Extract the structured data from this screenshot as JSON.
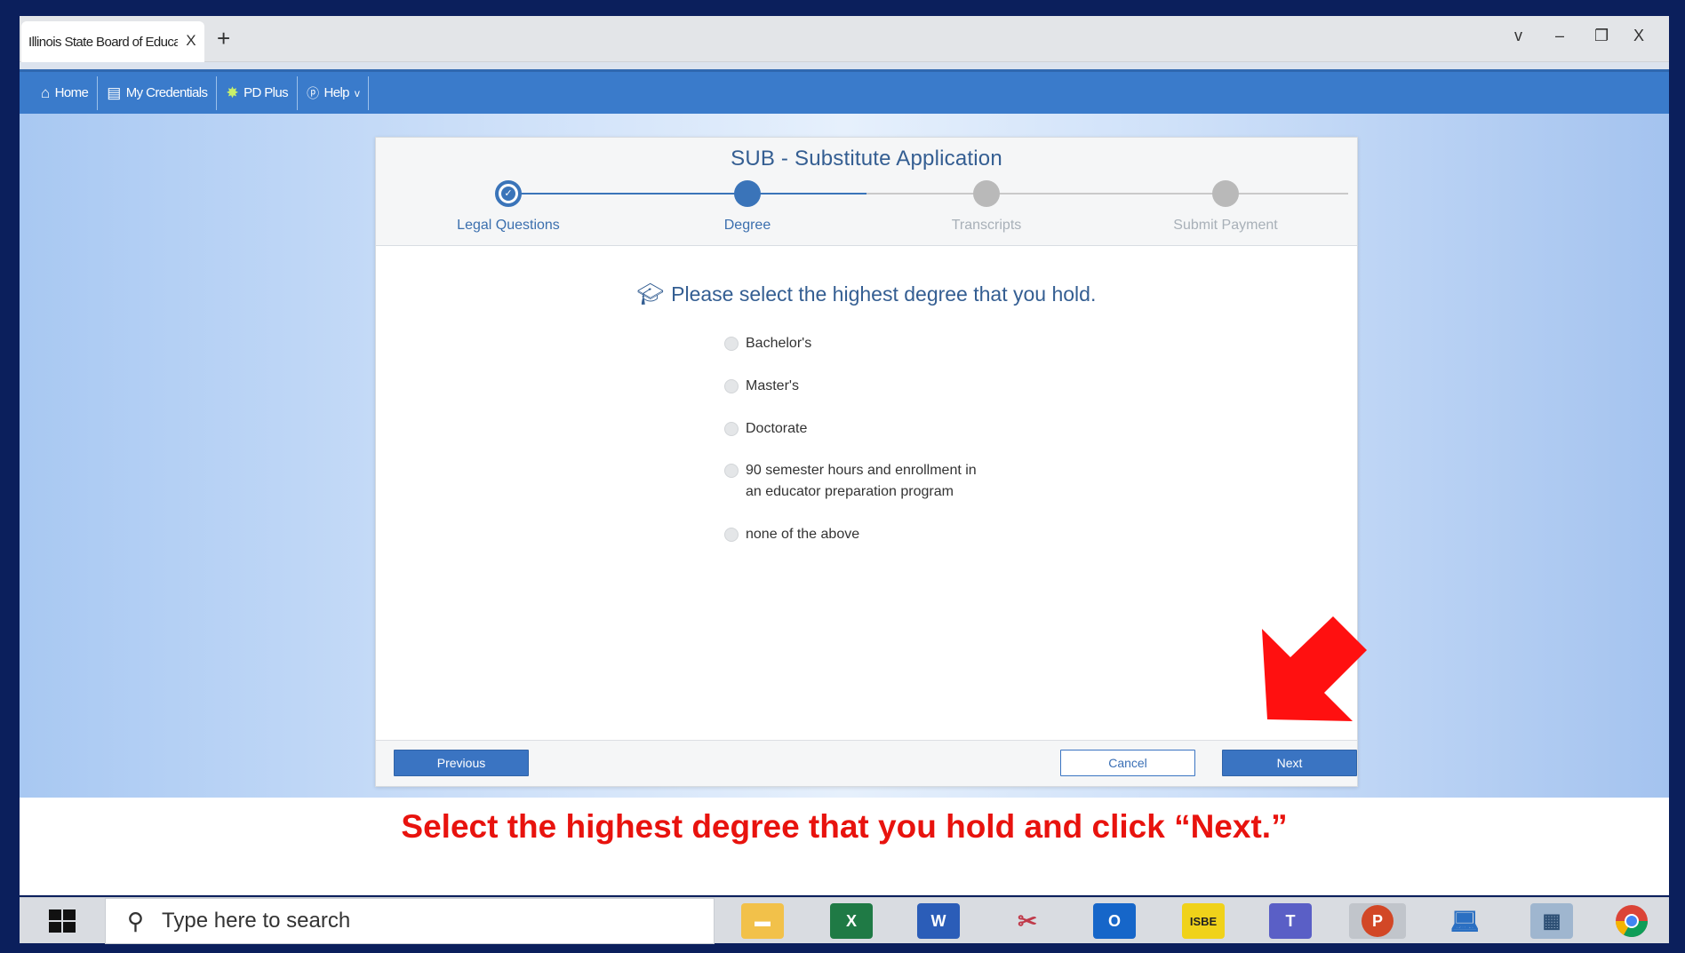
{
  "browser": {
    "tab_title": "Illinois State Board of Education",
    "tab_close": "X",
    "new_tab": "+",
    "controls": {
      "dropdown": "v",
      "minimize": "–",
      "restore": "❐",
      "close": "X"
    }
  },
  "navbar": {
    "items": [
      {
        "label": "Home",
        "icon": "home-icon"
      },
      {
        "label": "My Credentials",
        "icon": "credentials-icon"
      },
      {
        "label": "PD Plus",
        "icon": "lightbulb-icon"
      },
      {
        "label": "Help",
        "icon": "help-icon"
      }
    ],
    "help_chevron": "v"
  },
  "form": {
    "title": "SUB - Substitute Application",
    "steps": [
      {
        "label": "Legal Questions",
        "status": "done"
      },
      {
        "label": "Degree",
        "status": "active"
      },
      {
        "label": "Transcripts",
        "status": "todo"
      },
      {
        "label": "Submit Payment",
        "status": "todo"
      }
    ],
    "question": "Please select the highest degree that you hold.",
    "options": [
      "Bachelor's",
      "Master's",
      "Doctorate",
      "90 semester hours and enrollment in",
      "an educator preparation program",
      "none of the above"
    ],
    "buttons": {
      "previous": "Previous",
      "cancel": "Cancel",
      "next": "Next"
    }
  },
  "instruction": "Select the highest degree that you hold and click “Next.”",
  "taskbar": {
    "search_placeholder": "Type here to search",
    "apps": [
      "file-explorer",
      "excel",
      "word",
      "snipping-tool",
      "outlook",
      "isbe",
      "teams",
      "powerpoint",
      "laptop",
      "calculator",
      "chrome"
    ],
    "isbe_label": "ISBE"
  },
  "colors": {
    "accent": "#3a74c2",
    "navbar": "#3a7bcb",
    "instruction": "#e8130e",
    "arrow": "#ff1010"
  }
}
